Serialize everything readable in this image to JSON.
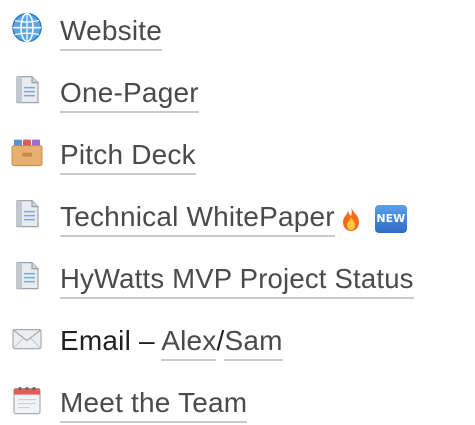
{
  "items": [
    {
      "icon": "globe-icon",
      "label": "Website"
    },
    {
      "icon": "page-with-curl-icon",
      "label": "One-Pager"
    },
    {
      "icon": "card-file-box-icon",
      "label": "Pitch Deck"
    },
    {
      "icon": "page-with-curl-icon",
      "label": "Technical WhitePaper",
      "extra_icon": "fire-icon",
      "badge": "NEW"
    },
    {
      "icon": "page-with-curl-icon",
      "label": "HyWatts MVP Project Status"
    },
    {
      "icon": "envelope-icon",
      "prefix": "Email – ",
      "link1": "Alex",
      "separator": "/",
      "link2": "Sam"
    },
    {
      "icon": "calendar-icon",
      "label": "Meet the Team"
    }
  ]
}
